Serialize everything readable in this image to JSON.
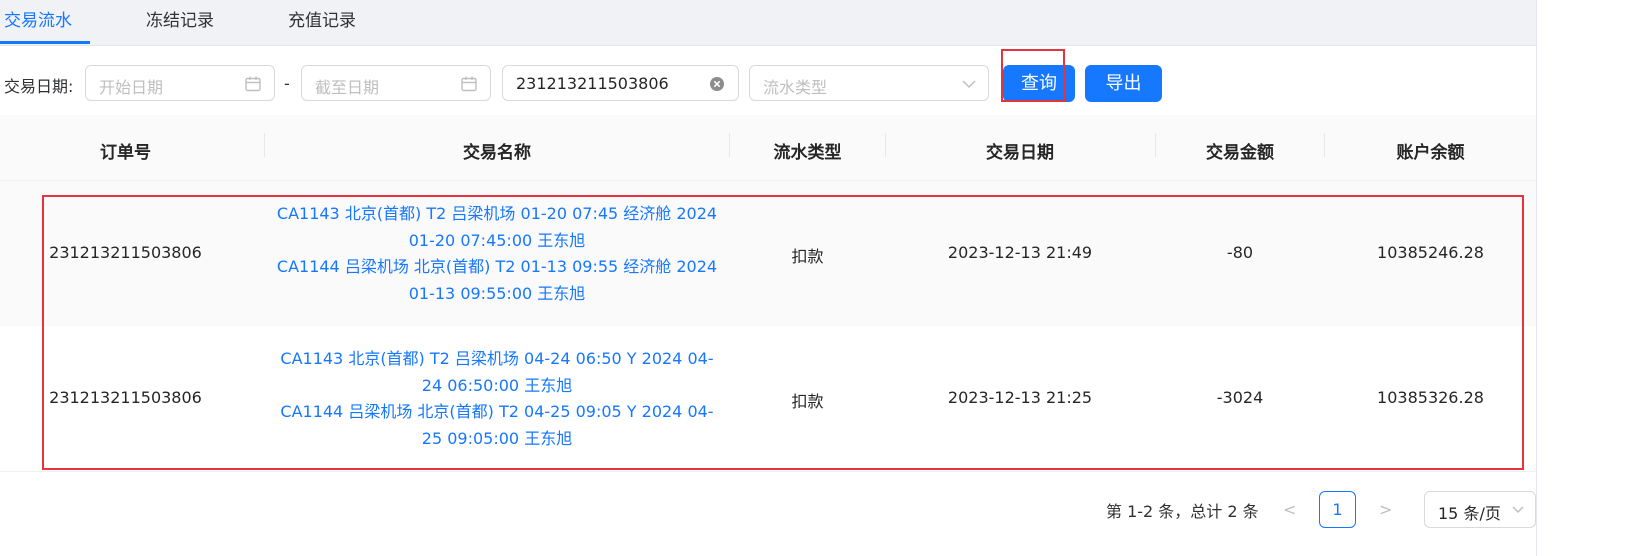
{
  "tabs": [
    {
      "label": "交易流水",
      "active": true
    },
    {
      "label": "冻结记录",
      "active": false
    },
    {
      "label": "充值记录",
      "active": false
    }
  ],
  "filters": {
    "date_label": "交易日期:",
    "start_placeholder": "开始日期",
    "separator": "-",
    "end_placeholder": "截至日期",
    "order_value": "231213211503806",
    "flow_type_placeholder": "流水类型",
    "query_label": "查询",
    "export_label": "导出"
  },
  "table": {
    "headers": [
      "订单号",
      "交易名称",
      "流水类型",
      "交易日期",
      "交易金额",
      "账户余额"
    ],
    "rows": [
      {
        "order_no": "231213211503806",
        "name_lines": [
          "CA1143 北京(首都) T2 吕梁机场 01-20 07:45 经济舱 2024",
          "01-20 07:45:00 王东旭",
          "CA1144 吕梁机场 北京(首都) T2 01-13 09:55 经济舱 2024",
          "01-13 09:55:00 王东旭"
        ],
        "flow_type": "扣款",
        "date": "2023-12-13 21:49",
        "amount": "-80",
        "balance": "10385246.28"
      },
      {
        "order_no": "231213211503806",
        "name_lines": [
          "CA1143 北京(首都) T2 吕梁机场 04-24 06:50 Y 2024 04-",
          "24 06:50:00 王东旭",
          "CA1144 吕梁机场 北京(首都) T2 04-25 09:05 Y 2024 04-",
          "25 09:05:00 王东旭"
        ],
        "flow_type": "扣款",
        "date": "2023-12-13 21:25",
        "amount": "-3024",
        "balance": "10385326.28"
      }
    ]
  },
  "pagination": {
    "total_text": "第 1-2 条，总计 2 条",
    "prev": "<",
    "current_page": "1",
    "next": ">",
    "page_size": "15 条/页"
  },
  "colors": {
    "accent": "#1677ff",
    "highlight": "#e5343b"
  }
}
